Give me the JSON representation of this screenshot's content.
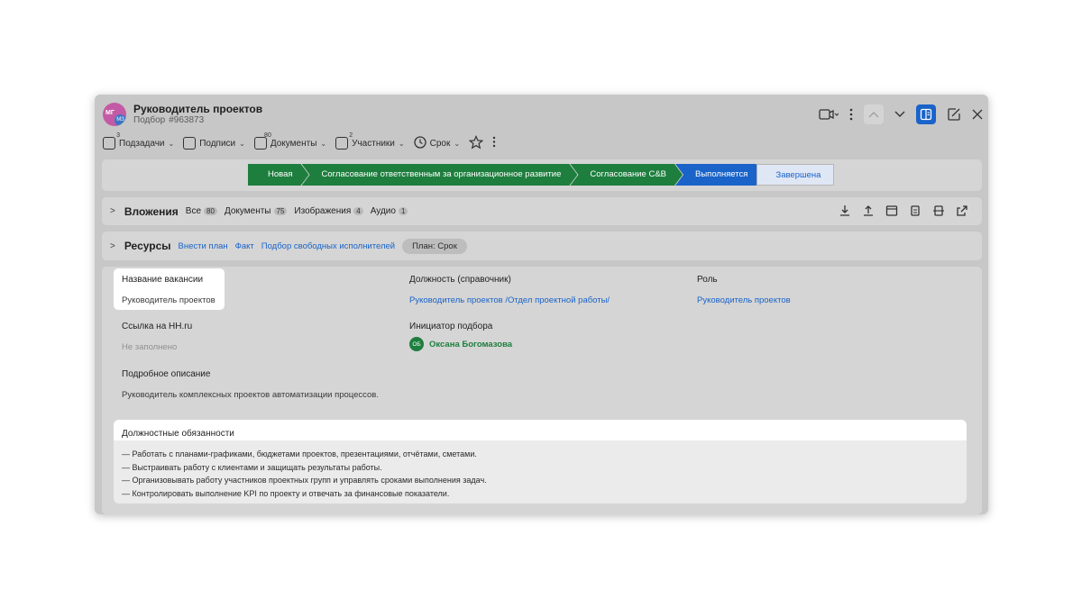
{
  "header": {
    "avatar_initials": "МГ",
    "avatar_badge": "МЗ",
    "title": "Руководитель проектов",
    "subtitle_label": "Подбор",
    "subtitle_id": "#963873"
  },
  "toolbar": {
    "items": [
      {
        "label": "Подзадачи",
        "count": "3"
      },
      {
        "label": "Подписи",
        "count": ""
      },
      {
        "label": "Документы",
        "count": "80"
      },
      {
        "label": "Участники",
        "count": "2"
      },
      {
        "label": "Срок",
        "count": ""
      }
    ]
  },
  "stages": [
    "Новая",
    "Согласование ответственным за организационное развитие",
    "Согласование C&B",
    "Выполняется",
    "Завершена"
  ],
  "attachments": {
    "title": "Вложения",
    "tabs": [
      {
        "label": "Все",
        "count": "80"
      },
      {
        "label": "Документы",
        "count": "75"
      },
      {
        "label": "Изображения",
        "count": "4"
      },
      {
        "label": "Аудио",
        "count": "1"
      }
    ]
  },
  "resources": {
    "title": "Ресурсы",
    "links": [
      "Внести план",
      "Факт",
      "Подбор свободных исполнителей"
    ],
    "pill": "План: Срок"
  },
  "fields": {
    "vacancy_label": "Название вакансии",
    "vacancy_value": "Руководитель проектов",
    "position_label": "Должность (справочник)",
    "position_value": "Руководитель проектов /Отдел проектной работы/",
    "role_label": "Роль",
    "role_value": "Руководитель проектов",
    "hh_label": "Ссылка на HH.ru",
    "hh_value": "Не заполнено",
    "initiator_label": "Инициатор подбора",
    "initiator_initials": "ОБ",
    "initiator_name": "Оксана Богомазова",
    "description_label": "Подробное описание",
    "description_value": "Руководитель комплексных проектов автоматизации процессов."
  },
  "duties": {
    "title": "Должностные обязанности",
    "items": [
      "— Работать с планами-графиками, бюджетами проектов, презентациями, отчётами, сметами.",
      "— Выстраивать работу с клиентами и защищать результаты работы.",
      "— Организовывать работу участников проектных групп и управлять сроками выполнения задач.",
      "— Контролировать выполнение KPI по проекту и отвечать за финансовые показатели."
    ]
  },
  "colors": {
    "accent_blue": "#1a63c9",
    "stage_green": "#1e7e3e",
    "overlay_gray": "#c7c7c7"
  }
}
